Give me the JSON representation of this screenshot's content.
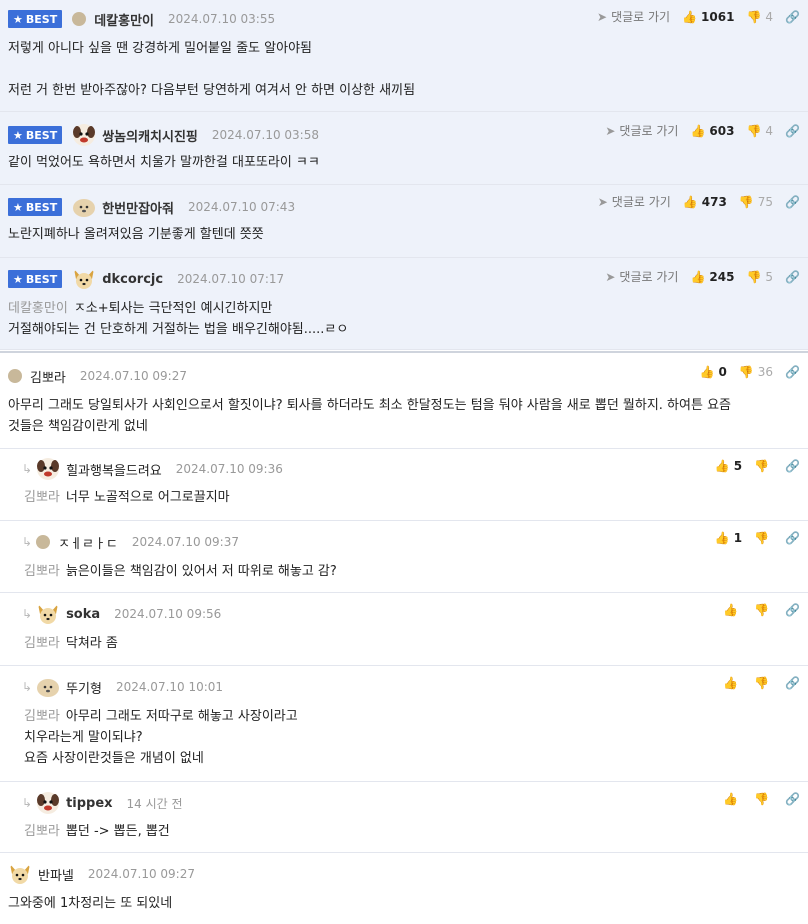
{
  "best_comments": [
    {
      "badge": "BEST",
      "nick": "데칼홍만이",
      "time": "2024.07.10 03:55",
      "reply": "댓글로 가기",
      "up": "1061",
      "down": "4",
      "lines": [
        "저렇게 아니다 싶을 땐 강경하게 밀어붙일 줄도 알아야됨",
        "",
        "저런 거 한번 받아주잖아? 다음부턴 당연하게 여겨서 안 하면 이상한 새끼됨"
      ]
    },
    {
      "badge": "BEST",
      "nick": "쌍놈의캐치시진핑",
      "time": "2024.07.10 03:58",
      "reply": "댓글로 가기",
      "up": "603",
      "down": "4",
      "lines": [
        "같이 먹었어도 욕하면서 치울가 말까한걸 대포또라이 ㅋㅋ"
      ]
    },
    {
      "badge": "BEST",
      "nick": "한번만잡아줘",
      "time": "2024.07.10 07:43",
      "reply": "댓글로 가기",
      "up": "473",
      "down": "75",
      "lines": [
        "노란지폐하나 올려져있음 기분좋게 할텐데 쯧쯧"
      ]
    },
    {
      "badge": "BEST",
      "nick": "dkcorcjc",
      "time": "2024.07.10 07:17",
      "reply": "댓글로 가기",
      "up": "245",
      "down": "5",
      "mention": "데칼홍만이",
      "lines": [
        "ㅈ소+퇴사는 극단적인 예시긴하지만",
        "거절해야되는 건 단호하게 거절하는 법을 배우긴해야됨.....ㄹㅇ"
      ]
    }
  ],
  "comments": [
    {
      "nick": "김뽀라",
      "time": "2024.07.10 09:27",
      "up": "0",
      "down": "36",
      "lines": [
        "아무리 그래도 당일퇴사가 사회인으로서 할짓이냐? 퇴사를 하더라도 최소 한달정도는 텀을 둬야 사람을 새로 뽑던 뭘하지. 하여튼 요즘",
        "것들은 책임감이란게 없네"
      ]
    },
    {
      "nick": "힐과행복을드려요",
      "time": "2024.07.10 09:36",
      "up": "5",
      "mention": "김뽀라",
      "lines": [
        "너무 노골적으로 어그로끌지마"
      ]
    },
    {
      "nick": "ㅈㅔㄹㅏㄷ",
      "time": "2024.07.10 09:37",
      "up": "1",
      "mention": "김뽀라",
      "lines": [
        "늙은이들은 책임감이 있어서 저 따위로 해놓고 감?"
      ]
    },
    {
      "nick": "soka",
      "time": "2024.07.10 09:56",
      "mention": "김뽀라",
      "lines": [
        "닥쳐라 좀"
      ]
    },
    {
      "nick": "뚜기형",
      "time": "2024.07.10 10:01",
      "mention": "김뽀라",
      "lines": [
        "아무리 그래도 저따구로 해놓고 사장이라고",
        "치우라는게 말이되냐?",
        "요즘 사장이란것들은 개념이 없네"
      ]
    },
    {
      "nick": "tippex",
      "time": "14 시간 전",
      "mention": "김뽀라",
      "lines": [
        "뽑던 -> 뽑든, 뽑건"
      ]
    },
    {
      "nick": "반파넬",
      "time": "2024.07.10 09:27",
      "lines": [
        "그와중에 1차정리는 또 되있네"
      ]
    }
  ],
  "icons": {
    "star": "star-icon",
    "reply": "reply-arrow-icon",
    "up": "thumbs-up-icon",
    "down": "thumbs-down-icon",
    "link": "link-icon",
    "nested": "nested-reply-icon"
  },
  "colors": {
    "best_bg": "#eef2fa",
    "badge": "#3b6fd9"
  }
}
